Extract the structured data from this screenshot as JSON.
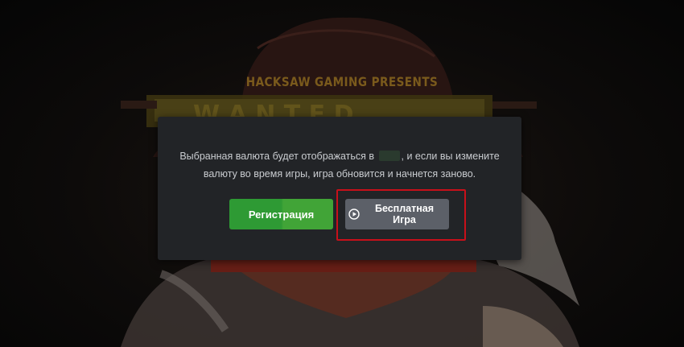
{
  "background": {
    "presents_text": "HACKSAW GAMING PRESENTS"
  },
  "dialog": {
    "message_line1_before": "Выбранная валюта будет отображаться в",
    "message_line1_after": ", и если вы измените",
    "message_line2": "валюту во время игры, игра обновится и начнется заново.",
    "register_button_label": "Регистрация",
    "free_play_button_label_line1": "Бесплатная",
    "free_play_button_label_line2": "Игра"
  },
  "colors": {
    "register_green": "#2e9a34",
    "free_play_gray": "#5c6068",
    "highlight_red": "#c8101a",
    "dialog_bg": "#222427"
  },
  "icons": {
    "free_play_icon": "play-circle-icon"
  }
}
